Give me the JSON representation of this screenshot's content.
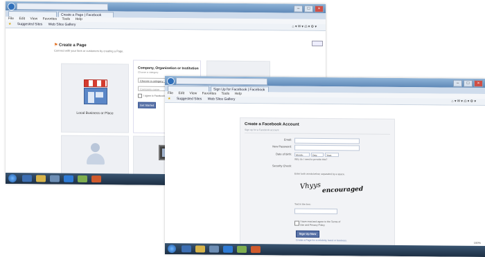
{
  "back_window": {
    "tabs": [
      "",
      "Create a Page | Facebook"
    ],
    "menu": [
      "File",
      "Edit",
      "View",
      "Favorites",
      "Tools",
      "Help"
    ],
    "favorites": [
      "Suggested Sites",
      "Web Slice Gallery"
    ],
    "page": {
      "title": "Create a Page",
      "subtitle": "Connect with your fans or customers by creating a Page.",
      "tiles": {
        "local_label": "Local Business or Place",
        "company_title": "Company, Organization or Institution",
        "company_sub": "Choose a category",
        "company_select": "Choose a category",
        "company_input": "Company name",
        "company_check": "I agree to Facebook Pages Terms",
        "company_button": "Get Started"
      }
    }
  },
  "front_window": {
    "tabs": [
      "",
      "Sign Up for Facebook | Facebook"
    ],
    "menu": [
      "File",
      "Edit",
      "View",
      "Favorites",
      "Tools",
      "Help"
    ],
    "favorites": [
      "Suggested Sites",
      "Web Slice Gallery"
    ],
    "form": {
      "title": "Create a Facebook Account",
      "subtitle": "Sign up for a Facebook account",
      "labels": {
        "email": "Email:",
        "password": "New Password:",
        "birthday": "Date of birth:",
        "security": "Security Check:"
      },
      "birthday_selects": [
        "Month:",
        "Day:",
        "Year:"
      ],
      "birthday_note": "Why do I need to provide this?",
      "security_note": "Enter both words below, separated by a space.",
      "captcha_words": [
        "Vhyys",
        "encouraged"
      ],
      "text_in_box_label": "Text in the box:",
      "terms_text": "I have read and agree to the Terms of Use and Privacy Policy",
      "signup_button": "Sign Up Now",
      "footnote": "Create a Page for a celebrity, band or business."
    },
    "zoom": "100%"
  }
}
